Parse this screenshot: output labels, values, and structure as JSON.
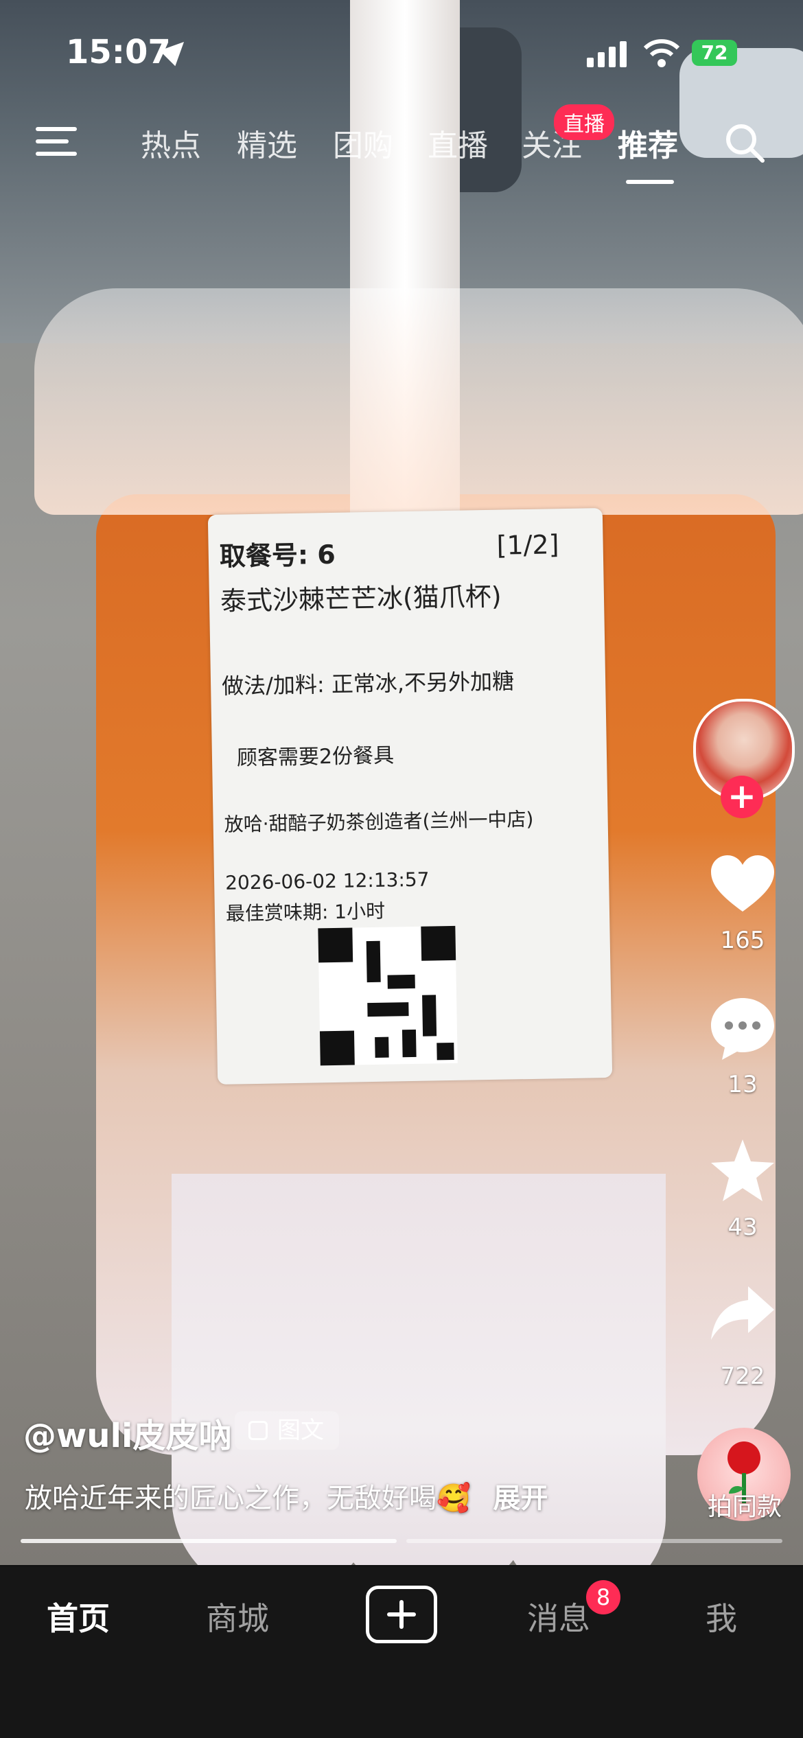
{
  "status_bar": {
    "time": "15:07",
    "battery": "72"
  },
  "top_tabs": {
    "items": [
      "热点",
      "精选",
      "团购",
      "直播",
      "关注",
      "推荐"
    ],
    "active": "推荐",
    "live_badge": "直播"
  },
  "post": {
    "username": "@wuli皮皮吶",
    "type_tag": "图文",
    "caption": "放哈近年来的匠心之作，无敌好喝🥰",
    "expand_label": "展开",
    "likes": "165",
    "comments": "13",
    "favorites": "43",
    "shares": "722",
    "same_style_label": "拍同款"
  },
  "receipt": {
    "pickup_label": "取餐号: 6",
    "page": "[1/2]",
    "product": "泰式沙棘芒芒冰(猫爪杯)",
    "method": "做法/加料: 正常冰,不另外加糖",
    "utensils": "顾客需要2份餐具",
    "store": "放哈·甜醅子奶茶创造者(兰州一中店)",
    "datetime": "2026-06-02 12:13:57",
    "best_before": "最佳赏味期: 1小时"
  },
  "bottom_nav": {
    "home": "首页",
    "mall": "商城",
    "messages": "消息",
    "messages_badge": "8",
    "me": "我"
  },
  "colors": {
    "accent": "#fe2c55",
    "nav_bg": "#161616",
    "battery": "#34c759"
  }
}
